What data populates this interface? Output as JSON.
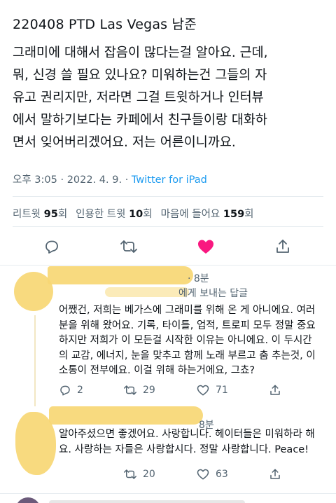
{
  "tweet": {
    "title": "220408 PTD Las Vegas 남준",
    "body": "그래미에 대해서 잡음이 많다는걸 알아요. 근데,\n뭐, 신경 쓸 필요 있나요? 미워하는건 그들의 자\n유고 권리지만, 저라면 그걸 트윗하거나 인터뷰\n에서 말하기보다는 카페에서 친구들이랑 대화하\n면서 잊어버리겠어요. 저는 어른이니까요.",
    "time": "오후 3:05",
    "date": "2022. 4. 9.",
    "client": "Twitter for iPad",
    "sep": "·"
  },
  "stats": {
    "retweets_label": "리트윗",
    "retweets_count": "95",
    "retweets_unit": "회",
    "quotes_label": "인용한 트윗",
    "quotes_count": "10",
    "quotes_unit": "회",
    "likes_label": "마음에 들어요",
    "likes_count": "159",
    "likes_unit": "회"
  },
  "icons": {
    "reply": "reply-icon",
    "retweet": "retweet-icon",
    "like": "heart-icon",
    "share": "share-icon"
  },
  "colors": {
    "like": "#f91880",
    "link": "#1d9bf0",
    "muted": "#536471",
    "redaction": "#f7d774"
  },
  "replies": [
    {
      "time": "· 8분",
      "replying_to": "에게 보내는 답글",
      "text": "어쨌건, 저희는 베가스에 그래미를 위해 온 게 아니에요. 여러\n분을 위해 왔어요. 기록, 타이틀, 업적, 트로피 모두 정말 중요\n하지만 저희가 이 모든걸 시작한 이유는 아니에요. 이 두시간\n의 교감, 에너지, 눈을 맞추고 함께 노래 부르고 춤 추는것, 이\n소통이 전부에요. 이걸 위해 하는거에요, 그쵸?",
      "replies": "2",
      "retweets": "29",
      "likes": "71"
    },
    {
      "time": "8분",
      "text": "알아주셨으면 좋겠어요. 사랑합니다. 헤이터들은 미워하라 해\n요. 사랑하는 자들은 사랑합시다. 정말 사랑합니다. Peace!",
      "retweets": "20",
      "likes": "63"
    }
  ]
}
